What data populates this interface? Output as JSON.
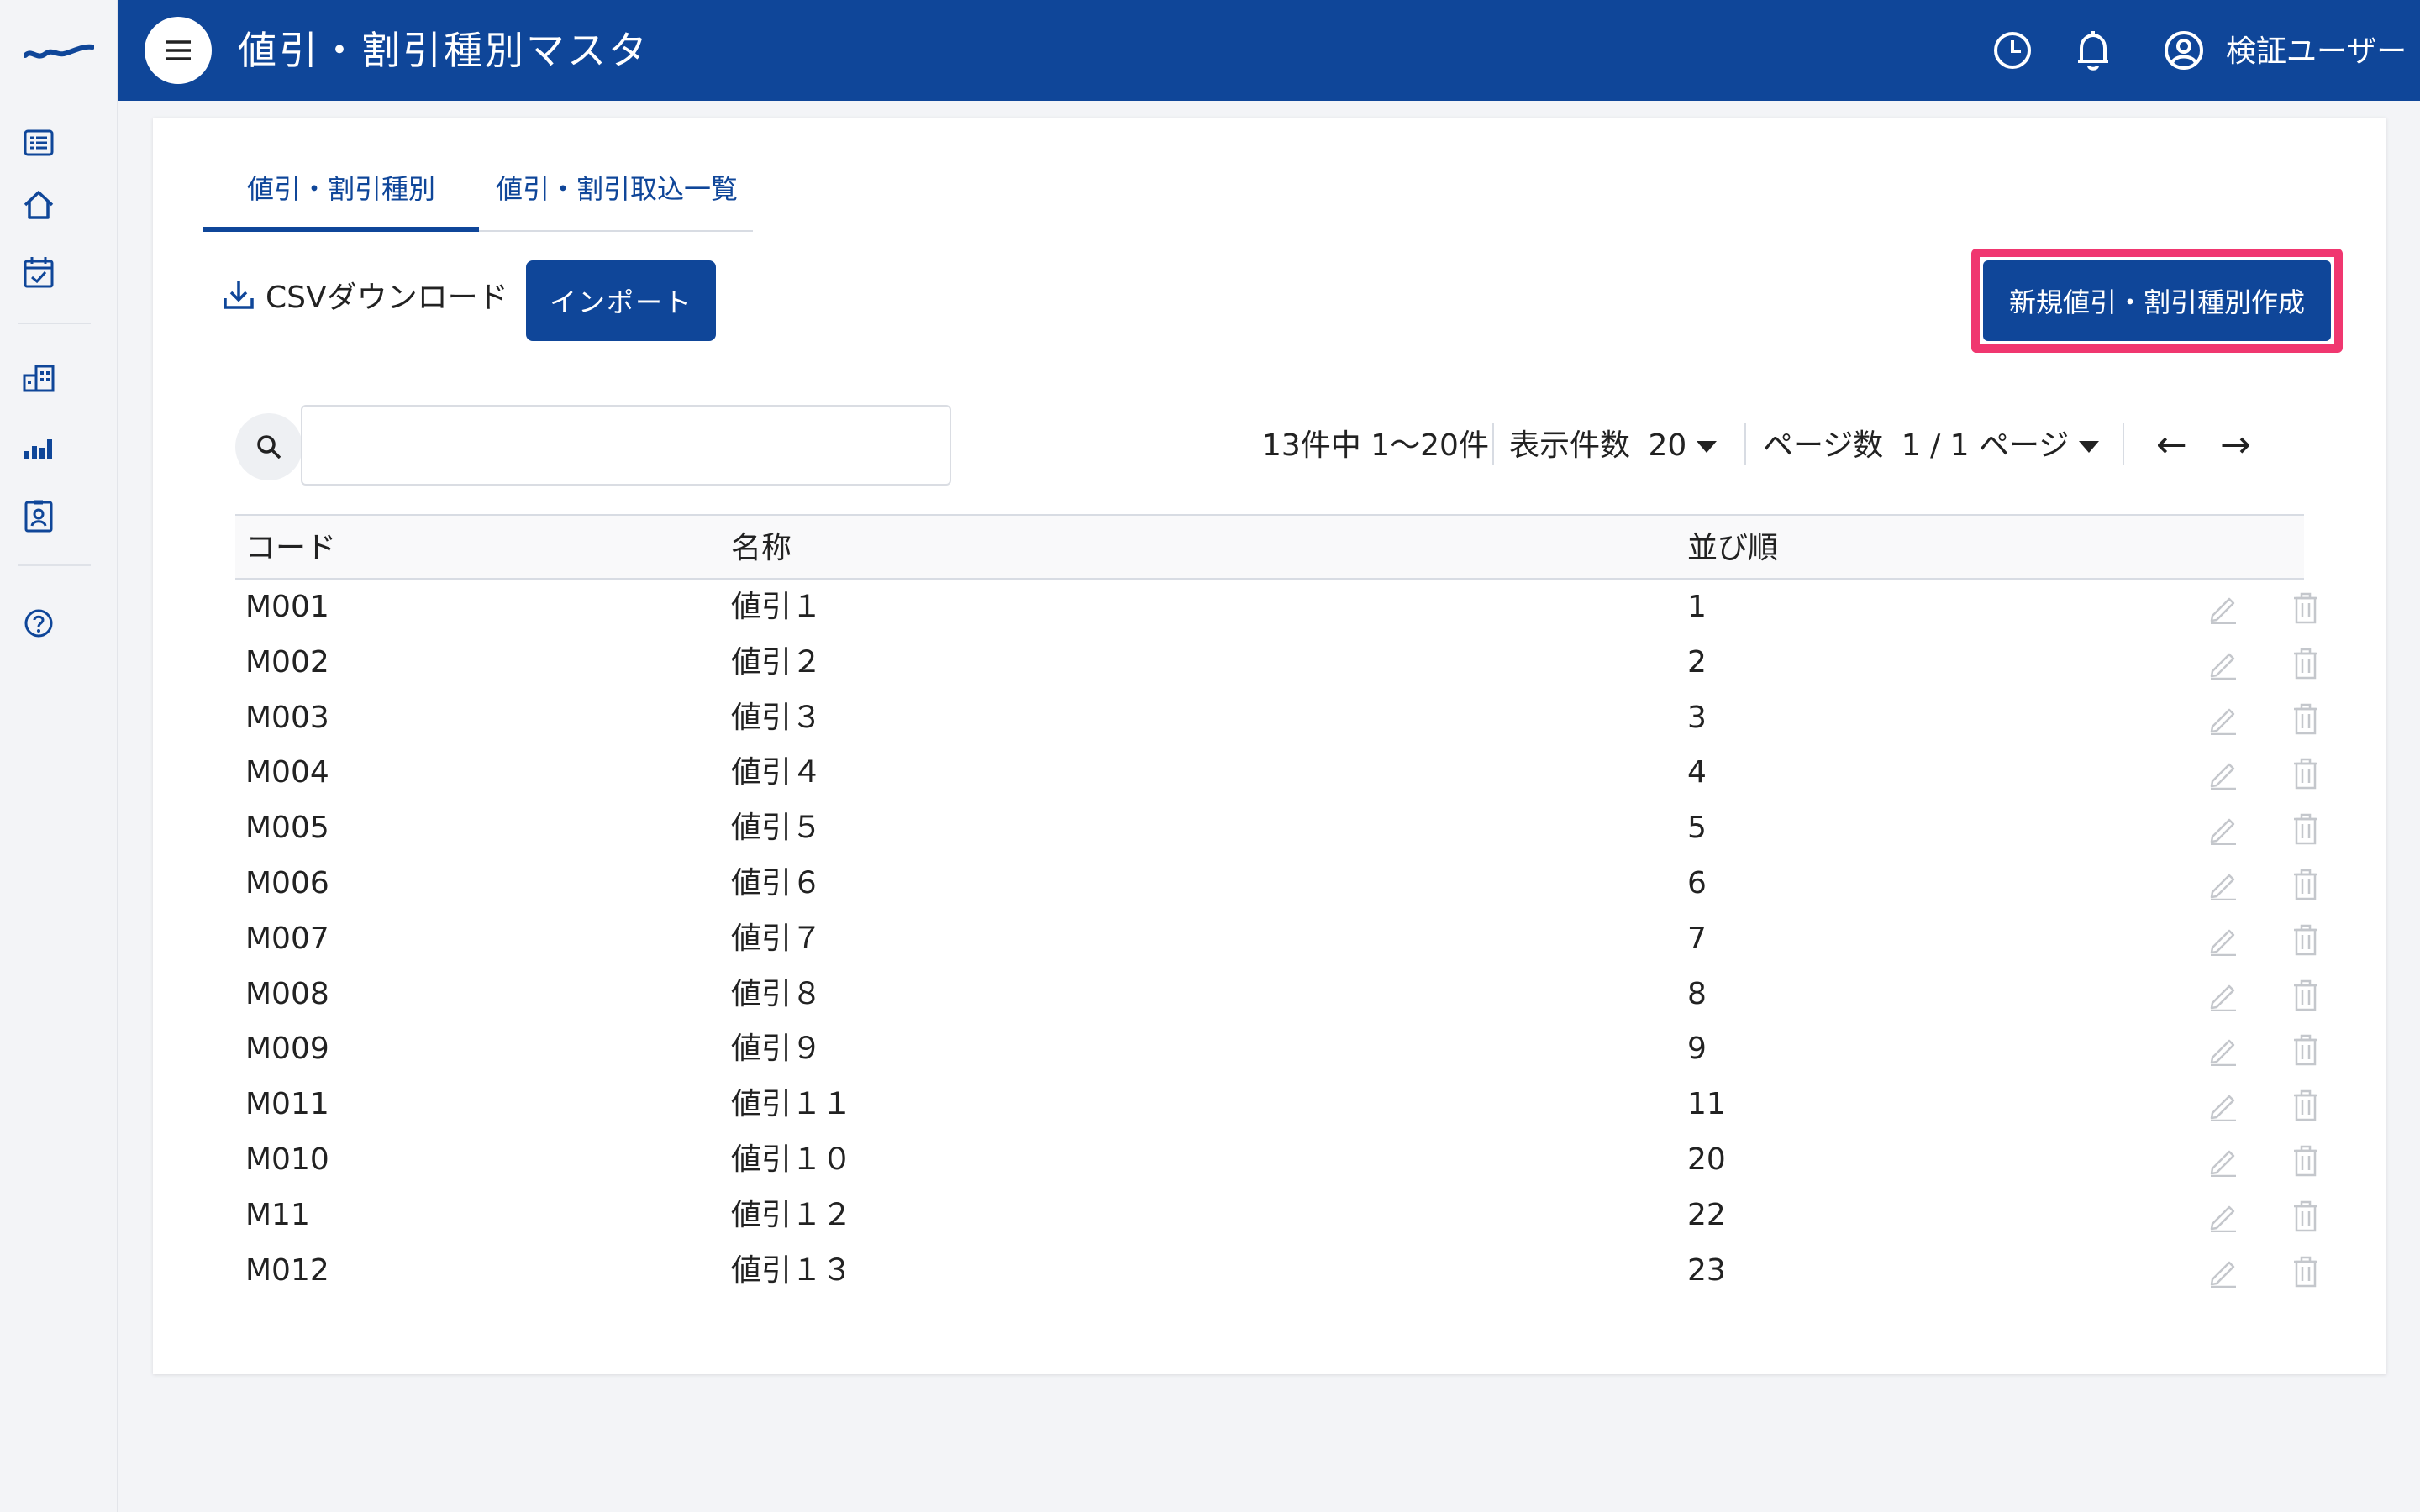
{
  "header": {
    "title": "値引・割引種別マスタ",
    "user_name": "検証ユーザー"
  },
  "tabs": [
    {
      "label": "値引・割引種別",
      "active": true
    },
    {
      "label": "値引・割引取込一覧",
      "active": false
    }
  ],
  "toolbar": {
    "csv_download_label": "CSVダウンロード",
    "import_label": "インポート",
    "new_label": "新規値引・割引種別作成"
  },
  "search": {
    "value": ""
  },
  "pagination": {
    "count_text": "13件中 1〜20件",
    "page_size_label": "表示件数",
    "page_size_value": "20",
    "page_label": "ページ数",
    "page_value": "1 / 1 ページ",
    "prev_arrow": "←",
    "next_arrow": "→"
  },
  "table": {
    "headers": [
      "コード",
      "名称",
      "並び順"
    ],
    "rows": [
      {
        "code": "M001",
        "name": "値引１",
        "order": "1"
      },
      {
        "code": "M002",
        "name": "値引２",
        "order": "2"
      },
      {
        "code": "M003",
        "name": "値引３",
        "order": "3"
      },
      {
        "code": "M004",
        "name": "値引４",
        "order": "4"
      },
      {
        "code": "M005",
        "name": "値引５",
        "order": "5"
      },
      {
        "code": "M006",
        "name": "値引６",
        "order": "6"
      },
      {
        "code": "M007",
        "name": "値引７",
        "order": "7"
      },
      {
        "code": "M008",
        "name": "値引８",
        "order": "8"
      },
      {
        "code": "M009",
        "name": "値引９",
        "order": "9"
      },
      {
        "code": "M011",
        "name": "値引１１",
        "order": "11"
      },
      {
        "code": "M010",
        "name": "値引１０",
        "order": "20"
      },
      {
        "code": "M11",
        "name": "値引１２",
        "order": "22"
      },
      {
        "code": "M012",
        "name": "値引１３",
        "order": "23"
      }
    ]
  },
  "colors": {
    "brand": "#0f4699",
    "highlight": "#f03770",
    "background": "#f3f4f7"
  },
  "icons": {
    "rail": [
      "list-icon",
      "home-icon",
      "calendar-check-icon",
      "building-icon",
      "bar-chart-icon",
      "id-badge-icon",
      "help-icon"
    ],
    "header": [
      "history-icon",
      "bell-icon",
      "user-icon"
    ],
    "row_actions": [
      "edit-icon",
      "trash-icon"
    ]
  }
}
